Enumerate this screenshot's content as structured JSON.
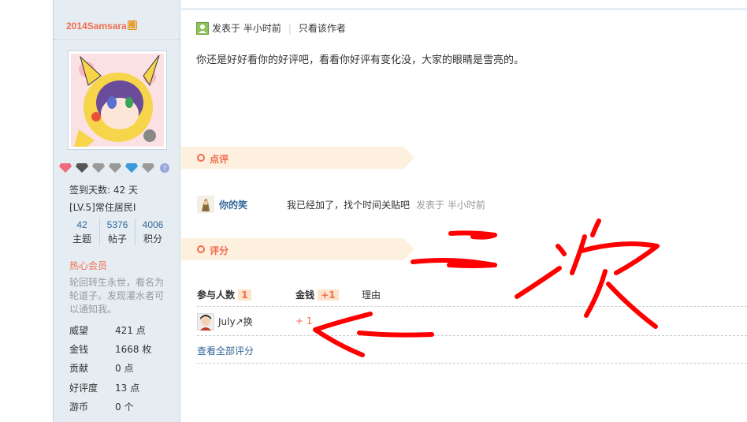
{
  "sidebar": {
    "username": "2014Samsara",
    "username_badge": "圈",
    "signin_days_label": "签到天数:",
    "signin_days_value": "42 天",
    "level": "[LV.5]常住居民I",
    "stats": [
      {
        "num": "42",
        "label": "主题"
      },
      {
        "num": "5376",
        "label": "帖子"
      },
      {
        "num": "4006",
        "label": "积分"
      }
    ],
    "vip": "热心会员",
    "description_lines": [
      "轮回转生永世，看名为",
      "轮道子。发现灌水者可",
      "以通知我。"
    ],
    "attributes": [
      {
        "key": "威望",
        "value": "421 点"
      },
      {
        "key": "金钱",
        "value": "1668 枚"
      },
      {
        "key": "贡献",
        "value": "0 点"
      },
      {
        "key": "好评度",
        "value": "13 点"
      },
      {
        "key": "游币",
        "value": "0 个"
      }
    ]
  },
  "post": {
    "posted_label": "发表于 半小时前",
    "separator": "|",
    "only_author": "只看该作者",
    "content": "你还是好好看你的好评吧，看看你好评有变化没，大家的眼睛是雪亮的。"
  },
  "comments_section": {
    "title": "点评",
    "items": [
      {
        "user": "你的笑",
        "text": "我已经加了，找个时间关贴吧",
        "time": "发表于 半小时前"
      }
    ]
  },
  "rating_section": {
    "title": "评分",
    "header_participants": "参与人数",
    "participants_count": "1",
    "header_money": "金钱",
    "money_total": "+1",
    "header_reason": "理由",
    "rows": [
      {
        "user": "July↗换",
        "money": "+ 1"
      }
    ],
    "view_all": "查看全部评分"
  },
  "colors": {
    "accent_orange": "#f26c4f",
    "link_blue": "#336699",
    "sidebar_bg": "#e5edf2",
    "section_bg": "#fdf0de",
    "annotation_red": "#ff0000"
  },
  "annotation": {
    "handwritten": "二次"
  }
}
